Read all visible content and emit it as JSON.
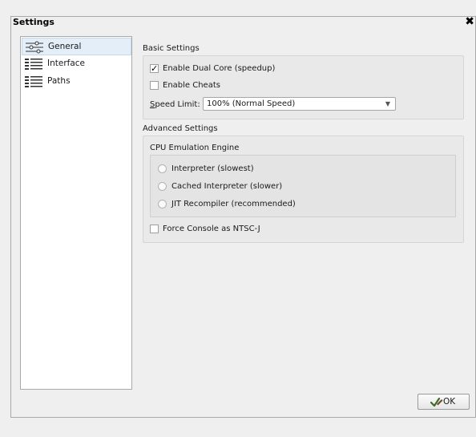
{
  "window": {
    "title": "Settings",
    "close_glyph": "✖"
  },
  "nav": {
    "items": [
      {
        "label": "General",
        "icon": "sliders-icon",
        "selected": true
      },
      {
        "label": "Interface",
        "icon": "list-icon",
        "selected": false
      },
      {
        "label": "Paths",
        "icon": "list-icon",
        "selected": false
      }
    ]
  },
  "basic": {
    "title": "Basic Settings",
    "dual_core": {
      "label": "Enable Dual Core (speedup)",
      "checked": true,
      "mark": "✓"
    },
    "cheats": {
      "label": "Enable Cheats",
      "checked": false
    },
    "speed_limit": {
      "label_prefix": "S",
      "label_rest": "peed Limit:",
      "value": "100% (Normal Speed)"
    }
  },
  "advanced": {
    "title": "Advanced Settings",
    "cpu_engine": {
      "title": "CPU Emulation Engine",
      "options": [
        "Interpreter (slowest)",
        "Cached Interpreter (slower)",
        "JIT Recompiler (recommended)"
      ]
    },
    "ntsc": {
      "label": "Force Console as NTSC-J",
      "checked": false
    }
  },
  "footer": {
    "ok_label": "OK",
    "ok_icon": "checkmark-pencil-icon"
  }
}
